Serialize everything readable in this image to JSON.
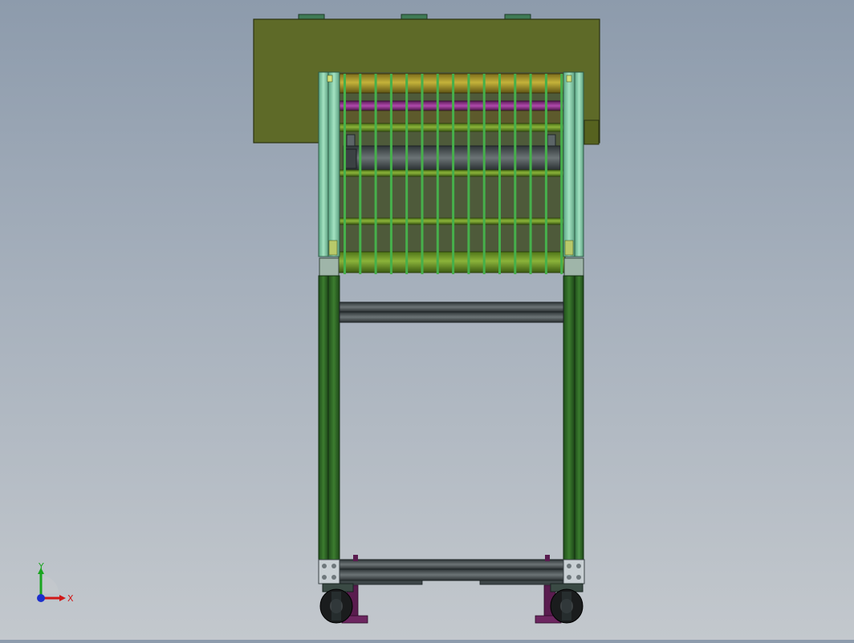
{
  "view": {
    "title": "",
    "background_top": "#8d9bac",
    "background_bottom": "#c3c8cd"
  },
  "triad": {
    "x_label": "X",
    "y_label": "Y",
    "x_color": "#d01818",
    "y_color": "#19a51f",
    "z_color": "#1c2fcc"
  },
  "model": {
    "hopper_color": "#5e6a28",
    "frame_color": "#2f6b25",
    "upper_frame_color": "#8fd3b0",
    "rod_color": "#46b04b",
    "roller_color": "#a99a2a",
    "shaft_color": "#8a2f86",
    "bar_color": "#4a5356",
    "foot_color": "#5a1c4f"
  }
}
